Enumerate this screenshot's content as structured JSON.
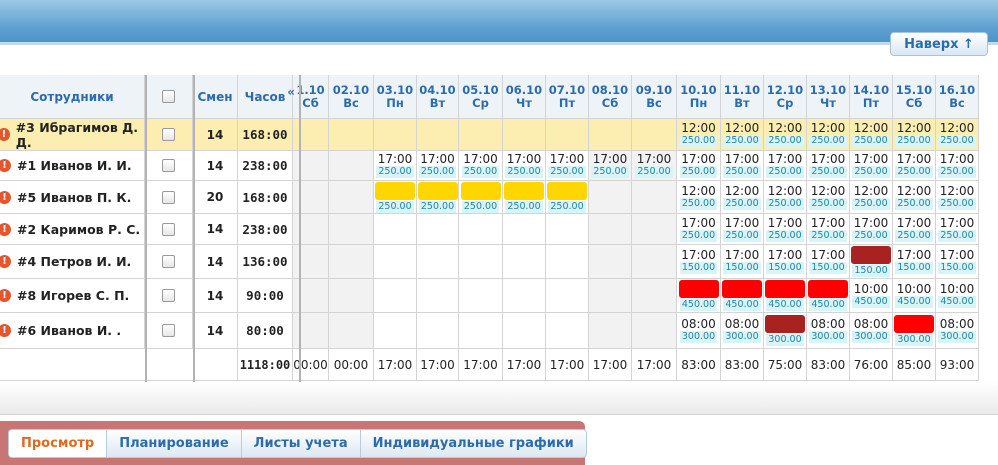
{
  "top_button": "Наверх ↑",
  "headers": {
    "employees": "Сотрудники",
    "shifts": "Смен",
    "hours": "Часов",
    "collapse": "«"
  },
  "days": [
    {
      "date": "1.10",
      "dow": "Сб"
    },
    {
      "date": "02.10",
      "dow": "Вс"
    },
    {
      "date": "03.10",
      "dow": "Пн"
    },
    {
      "date": "04.10",
      "dow": "Вт"
    },
    {
      "date": "05.10",
      "dow": "Ср"
    },
    {
      "date": "06.10",
      "dow": "Чт"
    },
    {
      "date": "07.10",
      "dow": "Пт"
    },
    {
      "date": "08.10",
      "dow": "Сб"
    },
    {
      "date": "09.10",
      "dow": "Вс"
    },
    {
      "date": "10.10",
      "dow": "Пн"
    },
    {
      "date": "11.10",
      "dow": "Вт"
    },
    {
      "date": "12.10",
      "dow": "Ср"
    },
    {
      "date": "13.10",
      "dow": "Чт"
    },
    {
      "date": "14.10",
      "dow": "Пт"
    },
    {
      "date": "15.10",
      "dow": "Сб"
    },
    {
      "date": "16.10",
      "dow": "Вс"
    }
  ],
  "colors": {
    "highlight_row": "#fbeeb0",
    "weekend": "#f2f2f2",
    "yellow_block": "#ffd600",
    "red_block": "#ff0000",
    "darkred_block": "#a82222"
  },
  "employees": [
    {
      "name": "#3 Ибрагимов Д. Д.",
      "shifts": "14",
      "hours": "168:00",
      "highlight": true,
      "cells": [
        null,
        null,
        null,
        null,
        null,
        null,
        null,
        null,
        null,
        {
          "t": "12:00",
          "p": "250.00"
        },
        {
          "t": "12:00",
          "p": "250.00"
        },
        {
          "t": "12:00",
          "p": "250.00"
        },
        {
          "t": "12:00",
          "p": "250.00"
        },
        {
          "t": "12:00",
          "p": "250.00"
        },
        {
          "t": "12:00",
          "p": "250.00"
        },
        {
          "t": "12:00",
          "p": "250.00"
        }
      ]
    },
    {
      "name": "#1 Иванов И. И.",
      "shifts": "14",
      "hours": "238:00",
      "cells": [
        null,
        null,
        {
          "t": "17:00",
          "p": "250.00"
        },
        {
          "t": "17:00",
          "p": "250.00"
        },
        {
          "t": "17:00",
          "p": "250.00"
        },
        {
          "t": "17:00",
          "p": "250.00"
        },
        {
          "t": "17:00",
          "p": "250.00"
        },
        {
          "t": "17:00",
          "p": "250.00"
        },
        {
          "t": "17:00",
          "p": "250.00"
        },
        {
          "t": "17:00",
          "p": "250.00"
        },
        {
          "t": "17:00",
          "p": "250.00"
        },
        {
          "t": "17:00",
          "p": "250.00"
        },
        {
          "t": "17:00",
          "p": "250.00"
        },
        {
          "t": "17:00",
          "p": "250.00"
        },
        {
          "t": "17:00",
          "p": "250.00"
        },
        {
          "t": "17:00",
          "p": "250.00"
        }
      ]
    },
    {
      "name": "#5 Иванов П. К.",
      "shifts": "20",
      "hours": "168:00",
      "cells": [
        null,
        null,
        {
          "b": "yellow",
          "p": "250.00"
        },
        {
          "b": "yellow",
          "p": "250.00"
        },
        {
          "b": "yellow",
          "p": "250.00"
        },
        {
          "b": "yellow",
          "p": "250.00"
        },
        {
          "b": "yellow",
          "p": "250.00"
        },
        null,
        null,
        {
          "t": "12:00",
          "p": "250.00"
        },
        {
          "t": "12:00",
          "p": "250.00"
        },
        {
          "t": "12:00",
          "p": "250.00"
        },
        {
          "t": "12:00",
          "p": "250.00"
        },
        {
          "t": "12:00",
          "p": "250.00"
        },
        {
          "t": "12:00",
          "p": "250.00"
        },
        {
          "t": "12:00",
          "p": "250.00"
        }
      ]
    },
    {
      "name": "#2 Каримов Р. С.",
      "shifts": "14",
      "hours": "238:00",
      "cells": [
        null,
        null,
        null,
        null,
        null,
        null,
        null,
        null,
        null,
        {
          "t": "17:00",
          "p": "250.00"
        },
        {
          "t": "17:00",
          "p": "250.00"
        },
        {
          "t": "17:00",
          "p": "250.00"
        },
        {
          "t": "17:00",
          "p": "250.00"
        },
        {
          "t": "17:00",
          "p": "250.00"
        },
        {
          "t": "17:00",
          "p": "250.00"
        },
        {
          "t": "17:00",
          "p": "250.00"
        }
      ]
    },
    {
      "name": "#4 Петров И. И.",
      "shifts": "14",
      "hours": "136:00",
      "cells": [
        null,
        null,
        null,
        null,
        null,
        null,
        null,
        null,
        null,
        {
          "t": "17:00",
          "p": "150.00"
        },
        {
          "t": "17:00",
          "p": "150.00"
        },
        {
          "t": "17:00",
          "p": "150.00"
        },
        {
          "t": "17:00",
          "p": "150.00"
        },
        {
          "b": "darkred",
          "p": "150.00"
        },
        {
          "t": "17:00",
          "p": "150.00"
        },
        {
          "t": "17:00",
          "p": "150.00"
        }
      ]
    },
    {
      "name": "#8 Игорев С. П.",
      "shifts": "14",
      "hours": "90:00",
      "cells": [
        null,
        null,
        null,
        null,
        null,
        null,
        null,
        null,
        null,
        {
          "b": "red",
          "p": "450.00"
        },
        {
          "b": "red",
          "p": "450.00"
        },
        {
          "b": "red",
          "p": "450.00"
        },
        {
          "b": "red",
          "p": "450.00"
        },
        {
          "t": "10:00",
          "p": "450.00"
        },
        {
          "t": "10:00",
          "p": "450.00"
        },
        {
          "t": "10:00",
          "p": "450.00"
        }
      ]
    },
    {
      "name": "#6 Иванов И. .",
      "shifts": "14",
      "hours": "80:00",
      "cells": [
        null,
        null,
        null,
        null,
        null,
        null,
        null,
        null,
        null,
        {
          "t": "08:00",
          "p": "300.00"
        },
        {
          "t": "08:00",
          "p": "300.00"
        },
        {
          "b": "darkred",
          "p": "300.00"
        },
        {
          "t": "08:00",
          "p": "300.00"
        },
        {
          "t": "08:00",
          "p": "300.00"
        },
        {
          "b": "red",
          "p": "300.00"
        },
        {
          "t": "08:00",
          "p": "300.00"
        }
      ]
    }
  ],
  "totals": {
    "hours": "1118:00",
    "days": [
      "00:00",
      "00:00",
      "17:00",
      "17:00",
      "17:00",
      "17:00",
      "17:00",
      "17:00",
      "17:00",
      "83:00",
      "83:00",
      "75:00",
      "83:00",
      "76:00",
      "85:00",
      "93:00"
    ]
  },
  "tabs": [
    "Просмотр",
    "Планирование",
    "Листы учета",
    "Индивидуальные графики"
  ]
}
